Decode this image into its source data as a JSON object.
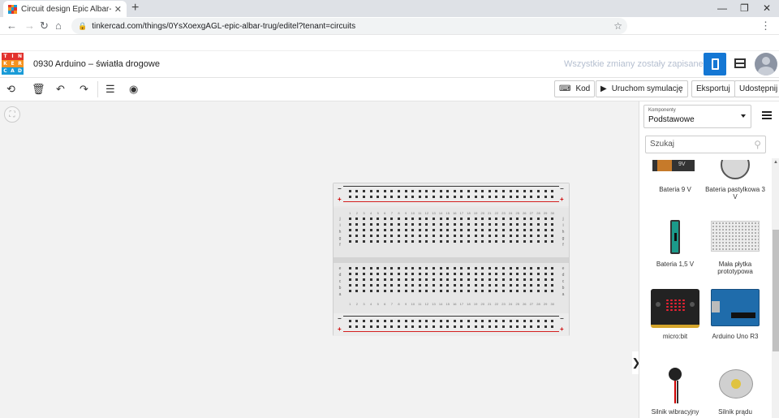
{
  "browser": {
    "tab_title": "Circuit design Epic Albar-Trug | T...",
    "url": "tinkercad.com/things/0YsXoexgAGL-epic-albar-trug/editel?tenant=circuits",
    "new_tab": "+",
    "tab_close": "✕",
    "win_minimize": "—",
    "win_maximize": "❐",
    "win_close": "✕"
  },
  "app": {
    "logo_letters": [
      "T",
      "I",
      "N",
      "K",
      "E",
      "R",
      "C",
      "A",
      "D"
    ],
    "logo_colors": [
      "#e2312c",
      "#e2312c",
      "#e2312c",
      "#f6921e",
      "#f6921e",
      "#f6921e",
      "#1a9bd7",
      "#1a9bd7",
      "#1a9bd7"
    ],
    "project_title": "0930 Arduino – światła drogowe",
    "save_status": "Wszystkie zmiany zostały zapisane"
  },
  "toolbar": {
    "code_label": "Kod",
    "simulate_label": "Uruchom symulację",
    "export_label": "Eksportuj",
    "share_label": "Udostępnij"
  },
  "breadboard": {
    "columns": 30,
    "row_letters_top": [
      "j",
      "i",
      "h",
      "g",
      "f"
    ],
    "row_letters_bottom": [
      "e",
      "d",
      "c",
      "b",
      "a"
    ]
  },
  "panel": {
    "components_label": "Komponenty",
    "components_value": "Podstawowe",
    "search_placeholder": "Szukaj",
    "items": [
      {
        "name": "Bateria 9 V",
        "icon": "battery-9v-icon"
      },
      {
        "name": "Bateria pastylkowa 3 V",
        "icon": "coin-cell-battery-icon"
      },
      {
        "name": "Bateria 1,5 V",
        "icon": "aa-battery-icon"
      },
      {
        "name": "Mała płytka prototypowa",
        "icon": "small-breadboard-icon"
      },
      {
        "name": "micro:bit",
        "icon": "microbit-icon"
      },
      {
        "name": "Arduino Uno R3",
        "icon": "arduino-uno-icon"
      },
      {
        "name": "Silnik wibracyjny",
        "icon": "vibration-motor-icon"
      },
      {
        "name": "Silnik prądu",
        "icon": "dc-motor-icon"
      }
    ]
  },
  "colors": {
    "accent": "#1477d4",
    "rail_red": "#d42020",
    "rail_dark": "#333333",
    "canvas_bg": "#f2f2f2"
  }
}
